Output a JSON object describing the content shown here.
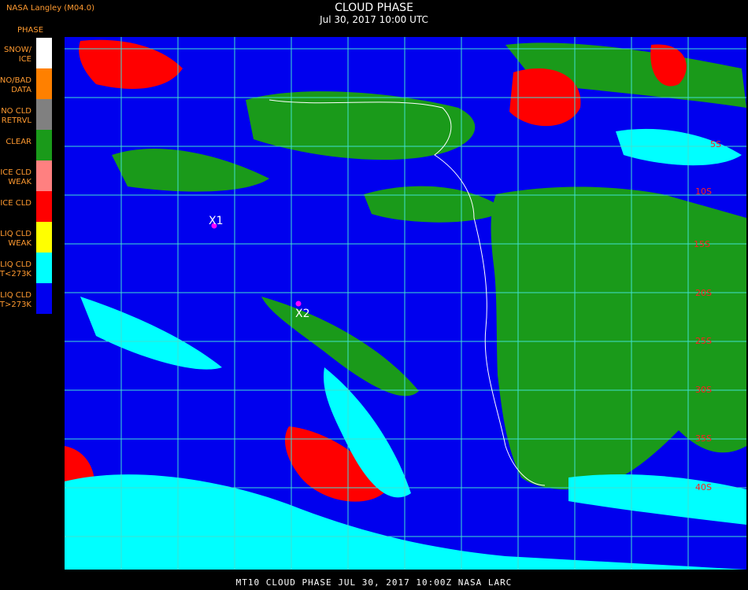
{
  "header": {
    "source": "NASA Langley (M04.0)",
    "legend_title": "PHASE",
    "title": "CLOUD PHASE",
    "subtitle": "Jul 30, 2017 10:00 UTC"
  },
  "legend": [
    {
      "label": "SNOW/\nICE",
      "color": "#ffffff"
    },
    {
      "label": "NO/BAD\nDATA",
      "color": "#ff8000"
    },
    {
      "label": "NO CLD\nRETRVL",
      "color": "#808080"
    },
    {
      "label": "CLEAR",
      "color": "#1a9a1a"
    },
    {
      "label": "ICE CLD\nWEAK",
      "color": "#ff8080"
    },
    {
      "label": "ICE CLD",
      "color": "#ff0000"
    },
    {
      "label": "LIQ CLD\nWEAK",
      "color": "#ffff00"
    },
    {
      "label": "LIQ CLD\nT<273K",
      "color": "#00ffff"
    },
    {
      "label": "LIQ CLD\nT>273K",
      "color": "#0000ee"
    }
  ],
  "markers": [
    {
      "label": "X1",
      "color": "#ff00ff"
    },
    {
      "label": "X2",
      "color": "#ff00ff"
    }
  ],
  "grid_labels": [
    "5S",
    "10S",
    "15S",
    "20S",
    "25S",
    "30S",
    "35S",
    "40S"
  ],
  "grid_color": "#40e0d0",
  "footer": "MT10  CLOUD PHASE  JUL 30, 2017 10:00Z  NASA LARC"
}
